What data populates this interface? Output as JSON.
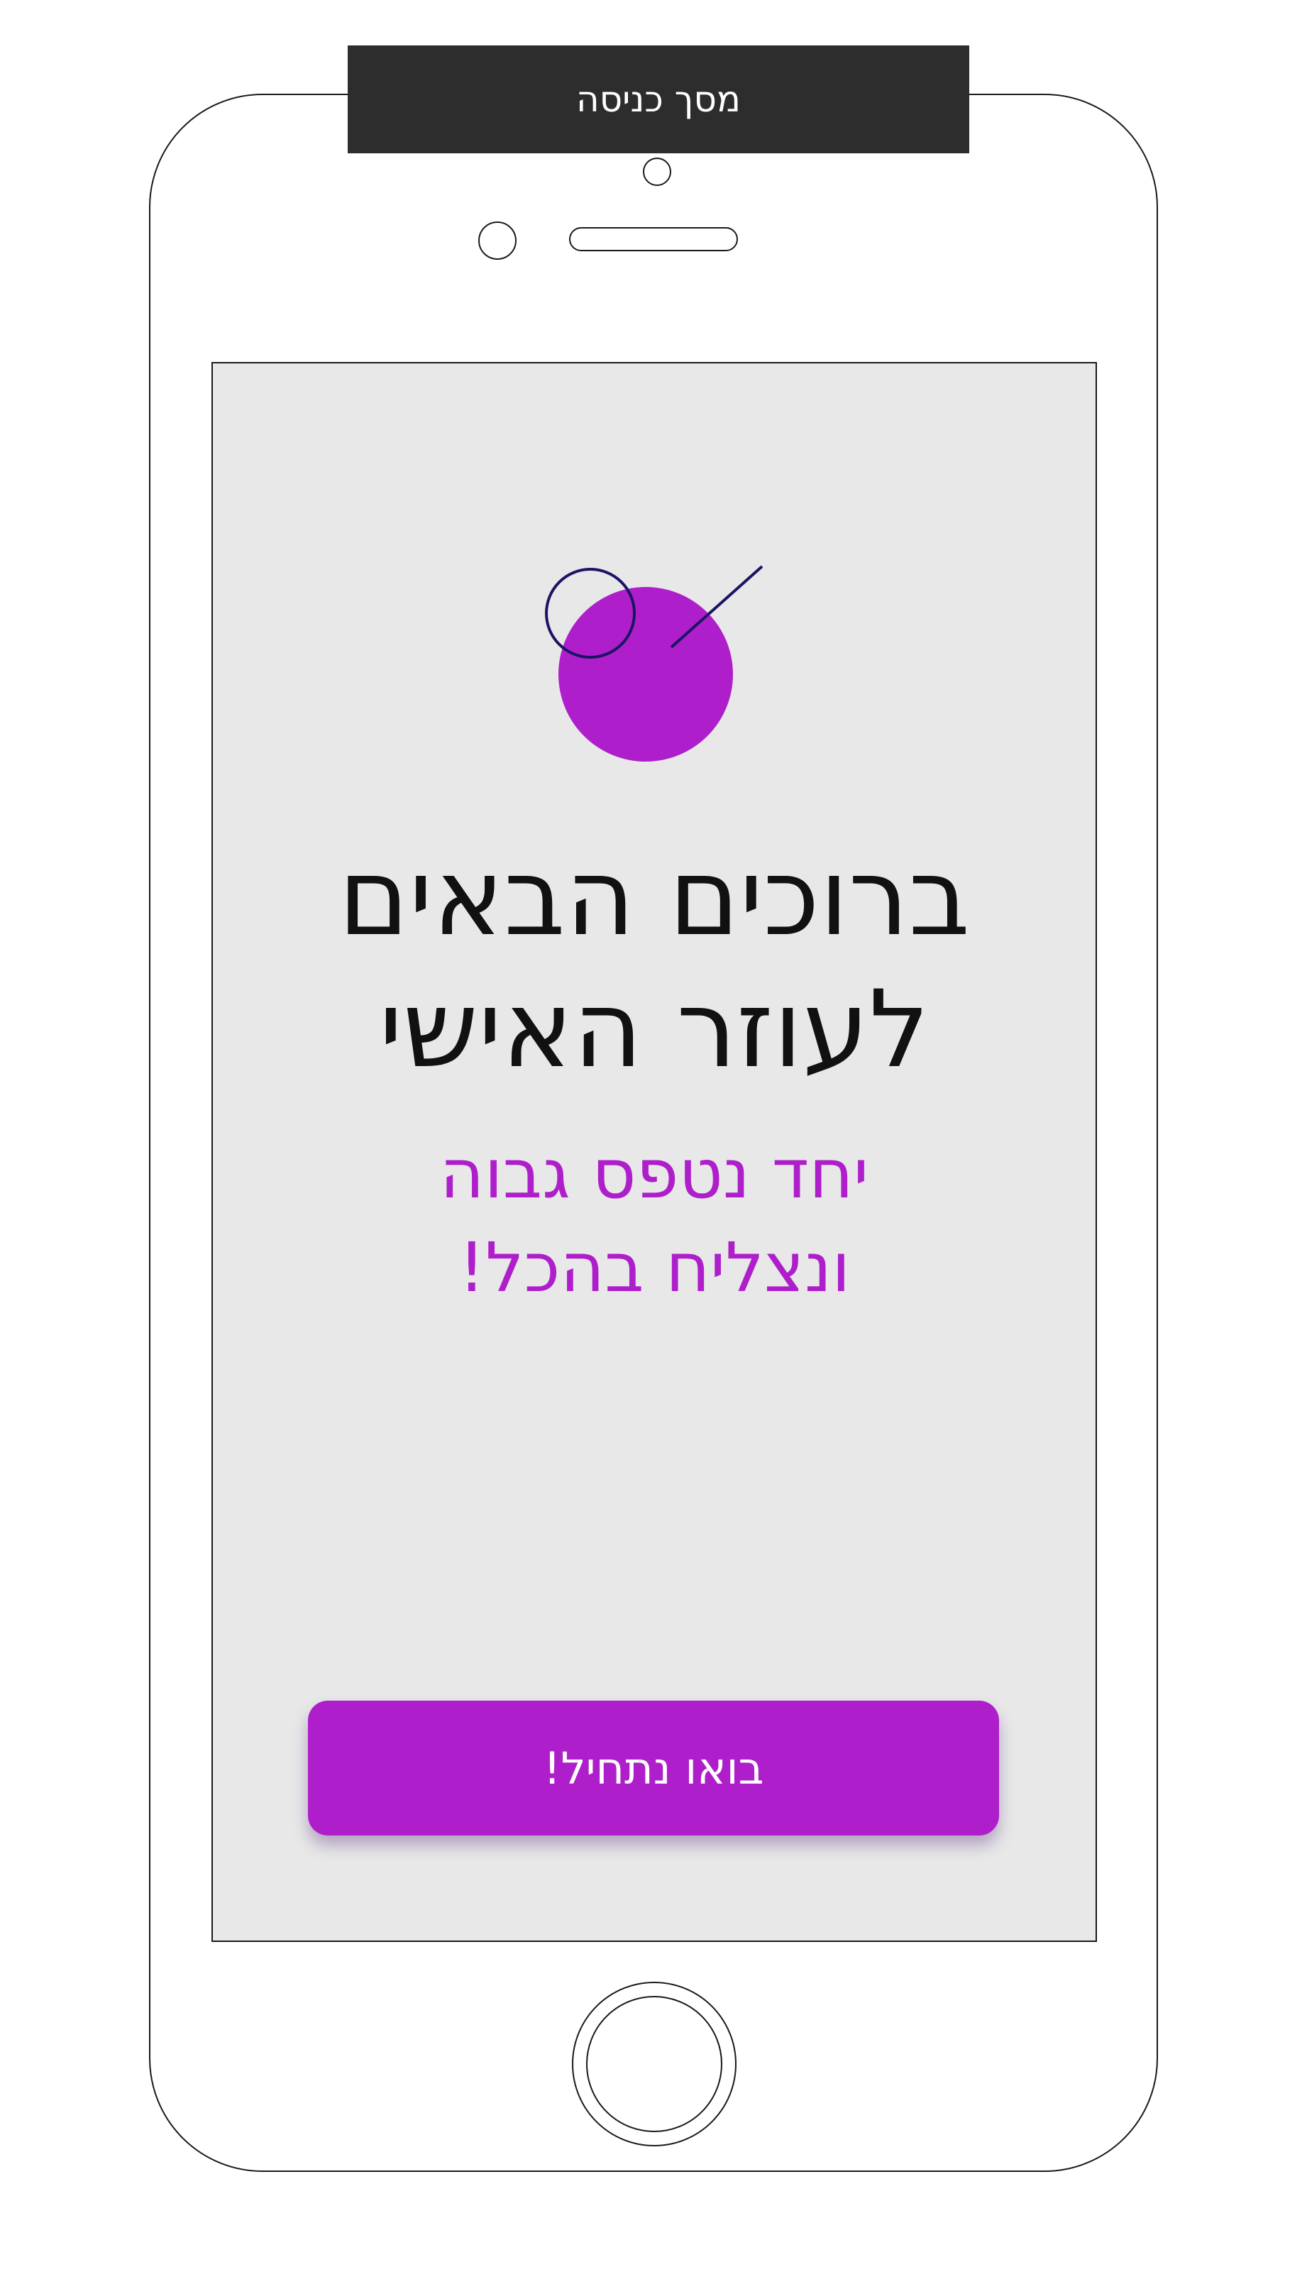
{
  "screen_title": "מסך כניסה",
  "welcome": {
    "headline_line1": "ברוכים הבאים",
    "headline_line2": "לעוזר האישי",
    "subtitle_line1": "יחד נטפס גבוה",
    "subtitle_line2": "ונצליח בהכל!"
  },
  "start_button_label": "בואו נתחיל!",
  "colors": {
    "accent": "#ae1fcb",
    "logo_outline": "#1b1464",
    "screen_background": "#e8e8e8",
    "title_tab_background": "#2d2d2d"
  }
}
